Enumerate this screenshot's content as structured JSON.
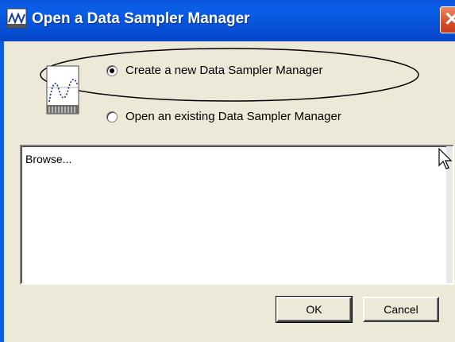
{
  "window": {
    "title": "Open a Data Sampler Manager",
    "app_icon": "data-sampler-app-icon",
    "close_icon": "close-icon"
  },
  "options": {
    "create_new": {
      "label": "Create a new Data Sampler Manager",
      "selected": true
    },
    "open_existing": {
      "label": "Open an existing Data Sampler Manager",
      "selected": false
    }
  },
  "illustration": {
    "icon": "data-sampler-waveform-icon"
  },
  "browse": {
    "text": "Browse..."
  },
  "buttons": {
    "ok": "OK",
    "cancel": "Cancel"
  },
  "colors": {
    "titlebar": "#0a55de",
    "dialog_bg": "#ece9d8",
    "close_button": "#d9502c"
  }
}
